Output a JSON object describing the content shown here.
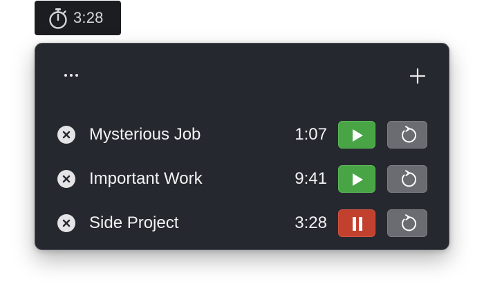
{
  "menubar": {
    "icon": "stopwatch-icon",
    "time": "3:28"
  },
  "popover": {
    "toolbar": {
      "more_icon": "ellipsis-icon",
      "add_icon": "plus-icon"
    },
    "timers": [
      {
        "name": "Mysterious Job",
        "time": "1:07",
        "state": "stopped",
        "action_icon": "play-icon"
      },
      {
        "name": "Important Work",
        "time": "9:41",
        "state": "stopped",
        "action_icon": "play-icon"
      },
      {
        "name": "Side Project",
        "time": "3:28",
        "state": "running",
        "action_icon": "pause-icon"
      }
    ],
    "icons": {
      "remove": "close-circle-icon",
      "reset": "reset-icon"
    }
  },
  "colors": {
    "panel_bg": "#26282f",
    "play_green": "#49a446",
    "pause_red": "#c2402e",
    "reset_gray": "#6b6c71"
  }
}
